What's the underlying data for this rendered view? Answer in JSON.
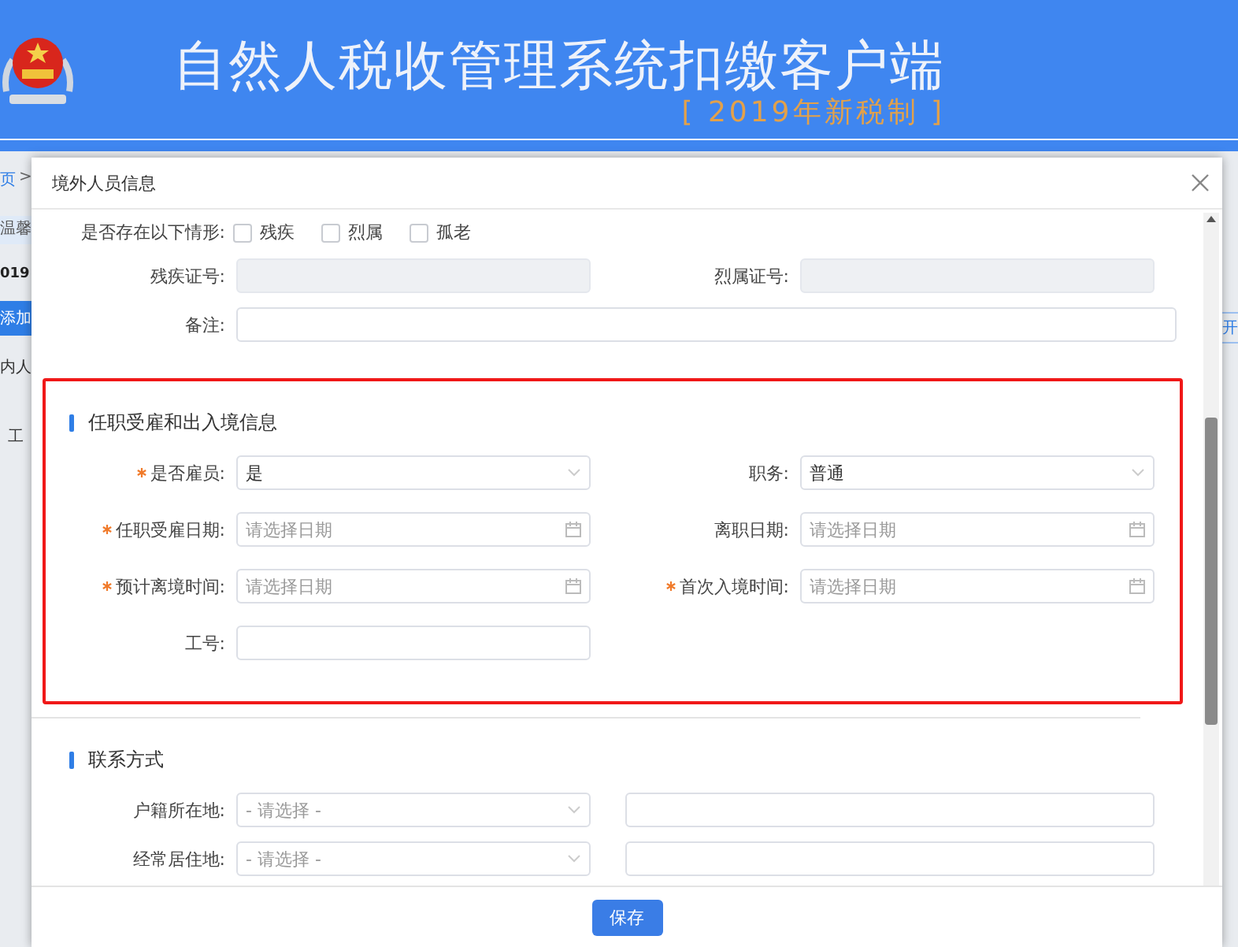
{
  "header": {
    "title": "自然人税收管理系统扣缴客户端",
    "subtitle": "[ 2019年新税制 ]"
  },
  "page_behind": {
    "breadcrumb": "页",
    "breadcrumb_separator": ">",
    "notice": "温馨",
    "year": "019",
    "add_button": "添加",
    "tab": "内人",
    "column": "工",
    "right_button": "开"
  },
  "dialog": {
    "title": "境外人员信息",
    "sections": [
      {
        "highlighted": false,
        "rows": [
          {
            "fields": [
              {
                "kind": "checkboxes",
                "label": "是否存在以下情形:",
                "required": false,
                "options": [
                  {
                    "label": "残疾",
                    "checked": false
                  },
                  {
                    "label": "烈属",
                    "checked": false
                  },
                  {
                    "label": "孤老",
                    "checked": false
                  }
                ]
              }
            ]
          },
          {
            "fields": [
              {
                "kind": "input",
                "label": "残疾证号:",
                "required": false,
                "disabled": true
              },
              {
                "kind": "input",
                "label": "烈属证号:",
                "required": false,
                "disabled": true
              }
            ]
          },
          {
            "fields": [
              {
                "kind": "wide",
                "label": "备注:",
                "required": false,
                "disabled": false
              }
            ]
          }
        ]
      },
      {
        "highlighted": true,
        "heading": "任职受雇和出入境信息",
        "rows": [
          {
            "fields": [
              {
                "kind": "select",
                "label": "是否雇员:",
                "required": true,
                "value": "是"
              },
              {
                "kind": "select",
                "label": "职务:",
                "required": false,
                "value": "普通"
              }
            ]
          },
          {
            "fields": [
              {
                "kind": "date",
                "label": "任职受雇日期:",
                "required": true,
                "placeholder": "请选择日期"
              },
              {
                "kind": "date",
                "label": "离职日期:",
                "required": false,
                "placeholder": "请选择日期"
              }
            ]
          },
          {
            "fields": [
              {
                "kind": "date",
                "label": "预计离境时间:",
                "required": true,
                "placeholder": "请选择日期"
              },
              {
                "kind": "date",
                "label": "首次入境时间:",
                "required": true,
                "placeholder": "请选择日期"
              }
            ]
          },
          {
            "fields": [
              {
                "kind": "input",
                "label": "工号:",
                "required": false,
                "disabled": false
              }
            ]
          }
        ]
      },
      {
        "highlighted": false,
        "heading": "联系方式",
        "rows": [
          {
            "fields": [
              {
                "kind": "select",
                "label": "户籍所在地:",
                "required": false,
                "placeholder": "- 请选择 -"
              },
              {
                "kind": "input",
                "disabled": false
              }
            ]
          },
          {
            "fields": [
              {
                "kind": "select",
                "label": "经常居住地:",
                "required": false,
                "placeholder": "- 请选择 -"
              },
              {
                "kind": "input",
                "disabled": false
              }
            ]
          }
        ]
      }
    ],
    "save_button": "保存"
  }
}
